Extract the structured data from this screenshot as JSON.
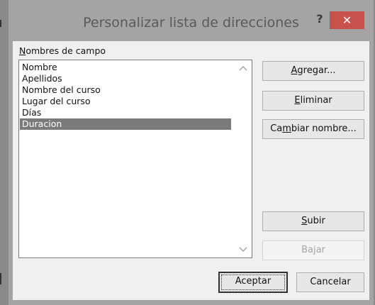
{
  "dialog": {
    "title": "Personalizar lista de direcciones",
    "help_label": "?",
    "close_label": "✕"
  },
  "fields": {
    "label_prefix": "N",
    "label_rest": "ombres de campo",
    "items": [
      {
        "label": "Nombre",
        "selected": false
      },
      {
        "label": "Apellidos",
        "selected": false
      },
      {
        "label": "Nombre del curso",
        "selected": false
      },
      {
        "label": "Lugar del curso",
        "selected": false
      },
      {
        "label": "Días",
        "selected": false
      },
      {
        "label": "Duracion",
        "selected": true
      }
    ],
    "scroll_up_icon": "chevron-up-icon",
    "scroll_down_icon": "chevron-down-icon"
  },
  "buttons": {
    "add": {
      "pre": "",
      "key": "A",
      "post": "gregar..."
    },
    "delete": {
      "pre": "",
      "key": "E",
      "post": "liminar"
    },
    "rename": {
      "pre": "Ca",
      "key": "m",
      "post": "biar nombre..."
    },
    "up": {
      "pre": "",
      "key": "S",
      "post": "ubir"
    },
    "down_label": "Bajar",
    "ok_label": "Aceptar",
    "cancel_label": "Cancelar"
  },
  "colors": {
    "close_button": "#c7524c",
    "selection": "#7a7a7a"
  }
}
